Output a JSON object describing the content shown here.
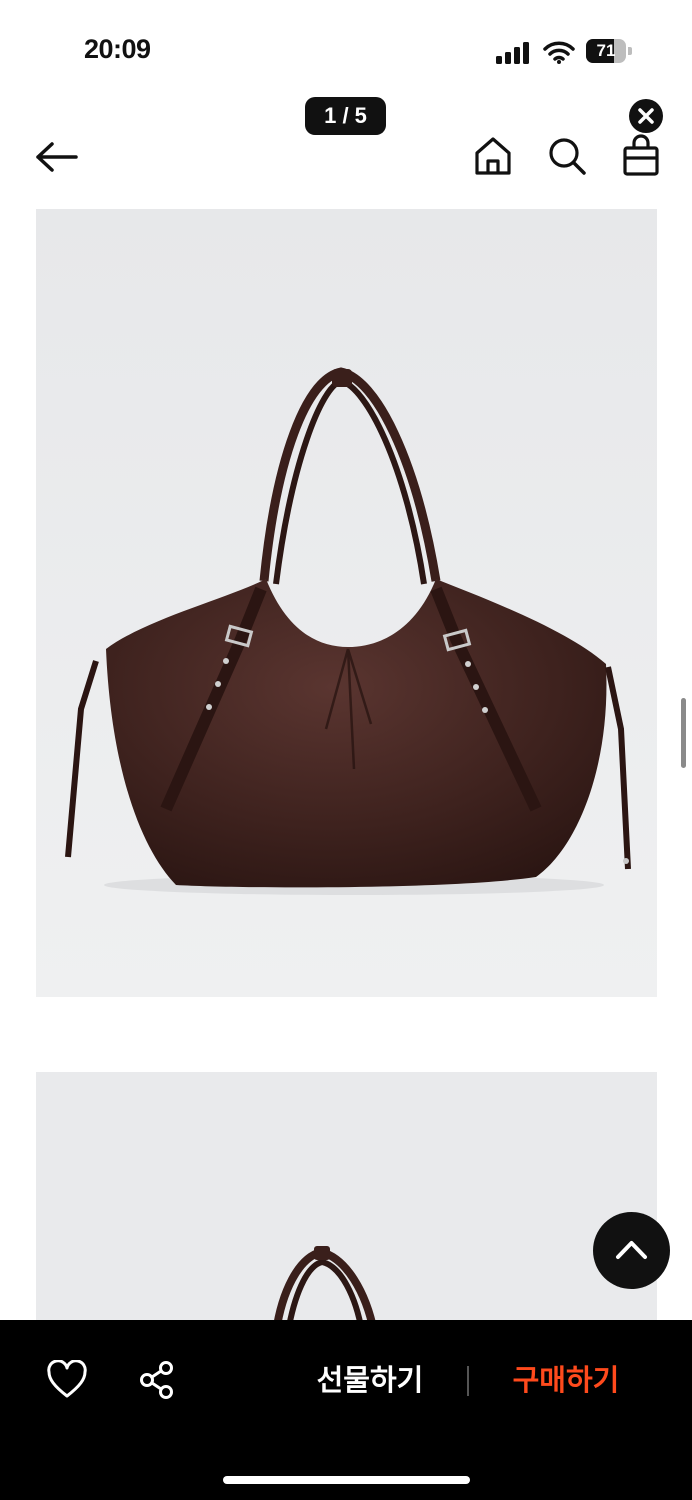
{
  "status_bar": {
    "time": "20:09",
    "battery_level": "71",
    "battery_fraction": 0.71,
    "icons": [
      "signal-icon",
      "wifi-icon",
      "battery-icon"
    ]
  },
  "gallery": {
    "counter": "1 / 5",
    "current_image": 1,
    "total_images": 5
  },
  "header": {
    "icons": [
      "back-arrow-icon",
      "home-icon",
      "search-icon",
      "shopping-bag-icon",
      "close-icon"
    ]
  },
  "product": {
    "bag_color": "#3a1f1b"
  },
  "bottom_bar": {
    "gift_label": "선물하기",
    "buy_label": "구매하기",
    "buy_color": "#ff4a1c",
    "icons": [
      "heart-icon",
      "share-icon",
      "chevron-up-icon"
    ]
  },
  "colors": {
    "background": "#ffffff",
    "image_background": "#e9eaec",
    "bottom_bar": "#000000"
  }
}
